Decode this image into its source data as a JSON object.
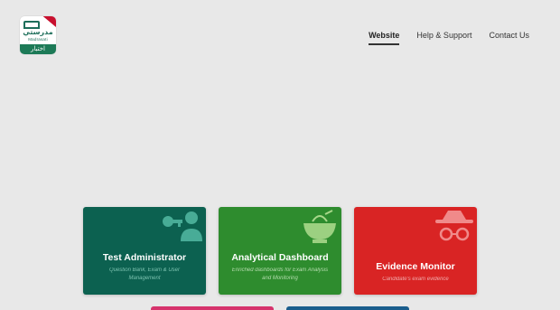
{
  "brand": {
    "logo_arabic_top": "مدرستي",
    "logo_latin": "Madrasati",
    "logo_arabic_band": "اختبار"
  },
  "nav": {
    "items": [
      {
        "label": "Website",
        "active": true
      },
      {
        "label": "Help & Support",
        "active": false
      },
      {
        "label": "Contact Us",
        "active": false
      }
    ]
  },
  "cards": [
    {
      "title": "Test Administrator",
      "description": "Question Bank, Exam & User Management",
      "color": "#0c6150",
      "icon": "user-key-icon"
    },
    {
      "title": "Analytical Dashboard",
      "description": "Enriched dashboards for Exam Analysis and Monitoring",
      "color": "#2e8c2e",
      "icon": "analytics-bowl-icon"
    },
    {
      "title": "Evidence Monitor",
      "description": "Candidate's exam evidence",
      "color": "#d92424",
      "icon": "spy-incognito-icon"
    }
  ],
  "partial_cards": [
    {
      "color": "#d6336c"
    },
    {
      "color": "#1a5d8c"
    }
  ]
}
